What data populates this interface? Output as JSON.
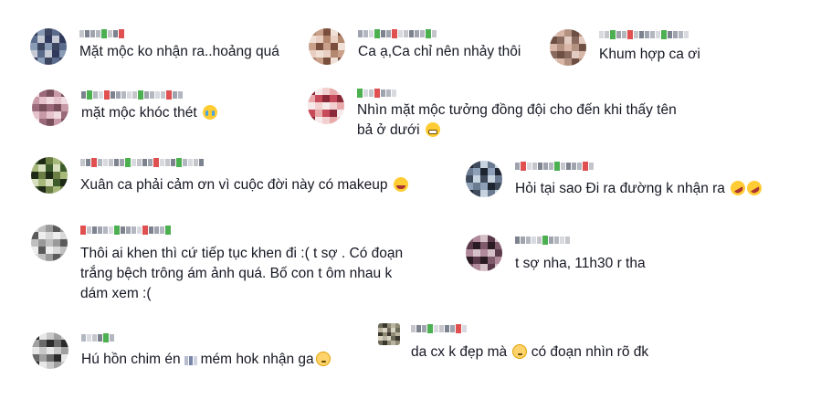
{
  "comments": [
    {
      "text": "Mặt mộc ko nhận ra..hoảng quá",
      "avatar_colors": [
        "#2f3a5c",
        "#5a6b8c",
        "#8a9bb5",
        "#c7cbd6",
        "#3c4560"
      ]
    },
    {
      "text": "Ca ạ,Ca chỉ nên nhảy thôi",
      "avatar_colors": [
        "#c9a08a",
        "#e8cfc2",
        "#7a4e3c",
        "#b4876f",
        "#f0e0d6"
      ]
    },
    {
      "text": "Khum hợp ca ơi",
      "avatar_colors": [
        "#b49282",
        "#e2ccc2",
        "#6e4f44",
        "#d9b7a8",
        "#8a6a5e"
      ]
    },
    {
      "text": "mặt mộc khóc thét",
      "emoji": "loudly-crying-face-icon",
      "avatar_colors": [
        "#c89aa8",
        "#9a6a7a",
        "#e6c3cc",
        "#7a4f5c",
        "#f0dbe0"
      ]
    },
    {
      "text_lines": [
        "Nhìn mặt mộc tưởng đồng đội cho đến khi thấy tên",
        "bả ở dưới"
      ],
      "emoji": "grimacing-face-icon",
      "avatar_colors": [
        "#c74a5a",
        "#f2d0d0",
        "#8a2a38",
        "#e7a9a9",
        "#f6eaea"
      ]
    },
    {
      "text": "Xuân ca phải cảm ơn vì cuộc đời này có makeup",
      "emoji": "grinning-squinting-face-icon",
      "avatar_colors": [
        "#3c5a2a",
        "#a7b97a",
        "#1f2a16",
        "#d7dfbf",
        "#6b7f44"
      ]
    },
    {
      "text": "Hỏi tại sao Đi ra đường k nhận ra",
      "emoji": "rolling-on-floor-laughing-icon",
      "avatar_colors": [
        "#3f4a5c",
        "#8ea0b8",
        "#c8d3e0",
        "#1e2530",
        "#6a7a90"
      ]
    },
    {
      "text_lines": [
        "Thôi ai khen thì cứ tiếp tục khen đi :( t sợ . Có đoạn",
        "trắng bệch trông ám ảnh quá. Bố con t ôm nhau k",
        "dám xem :("
      ],
      "avatar_colors": [
        "#9a9a9a",
        "#d8d8d8",
        "#5a5a5a",
        "#bfbfbf",
        "#eeeeee"
      ]
    },
    {
      "text": "t sợ nha, 11h30 r tha",
      "avatar_colors": [
        "#5a3a4a",
        "#b08a9a",
        "#2a1a22",
        "#d6c0c8",
        "#7e5a6a"
      ]
    },
    {
      "text_before": "Hú hồn chim én",
      "text_after": "mém hok nhận ga",
      "emoji": "flushed-face-icon",
      "avatar_colors": [
        "#6a6a6a",
        "#c8c8c8",
        "#2a2a2a",
        "#a0a0a0",
        "#e8e8e8"
      ]
    },
    {
      "text_before": "da cx k đẹp mà",
      "text_after": "có đoạn nhìn rõ đk",
      "emoji": "flushed-face-icon",
      "avatar_colors": [
        "#6e6a5a",
        "#b8b4a0",
        "#3a372c",
        "#d8d4c4",
        "#8e8a74"
      ]
    }
  ]
}
